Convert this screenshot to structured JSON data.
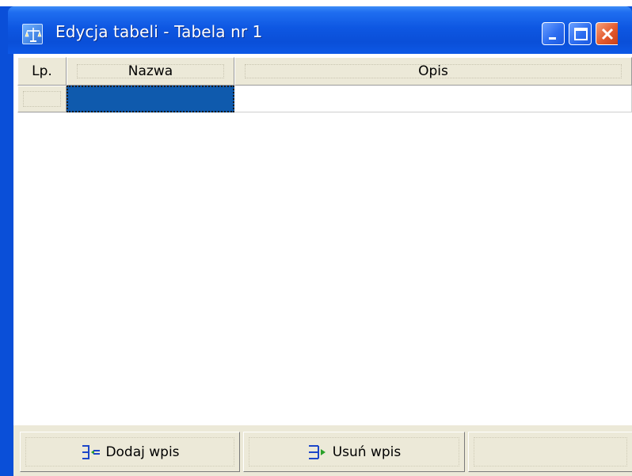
{
  "window": {
    "title": "Edycja tabeli - Tabela nr 1",
    "app_icon": "scales-icon",
    "controls": [
      "minimize-icon",
      "maximize-icon",
      "close-icon"
    ]
  },
  "grid": {
    "columns": [
      "Lp.",
      "Nazwa",
      "Opis"
    ],
    "rows": [
      {
        "lp": "",
        "nazwa": "",
        "opis": ""
      }
    ],
    "selected_cell": "Nazwa"
  },
  "buttons": {
    "add_label": "Dodaj wpis",
    "add_icon": "add-row-icon",
    "remove_label": "Usuń wpis",
    "remove_icon": "remove-row-icon"
  },
  "colors": {
    "titlebar": "#0a4fd8",
    "selection": "#0f5aad",
    "face": "#ece9d8",
    "close_button": "#e35a2e"
  }
}
